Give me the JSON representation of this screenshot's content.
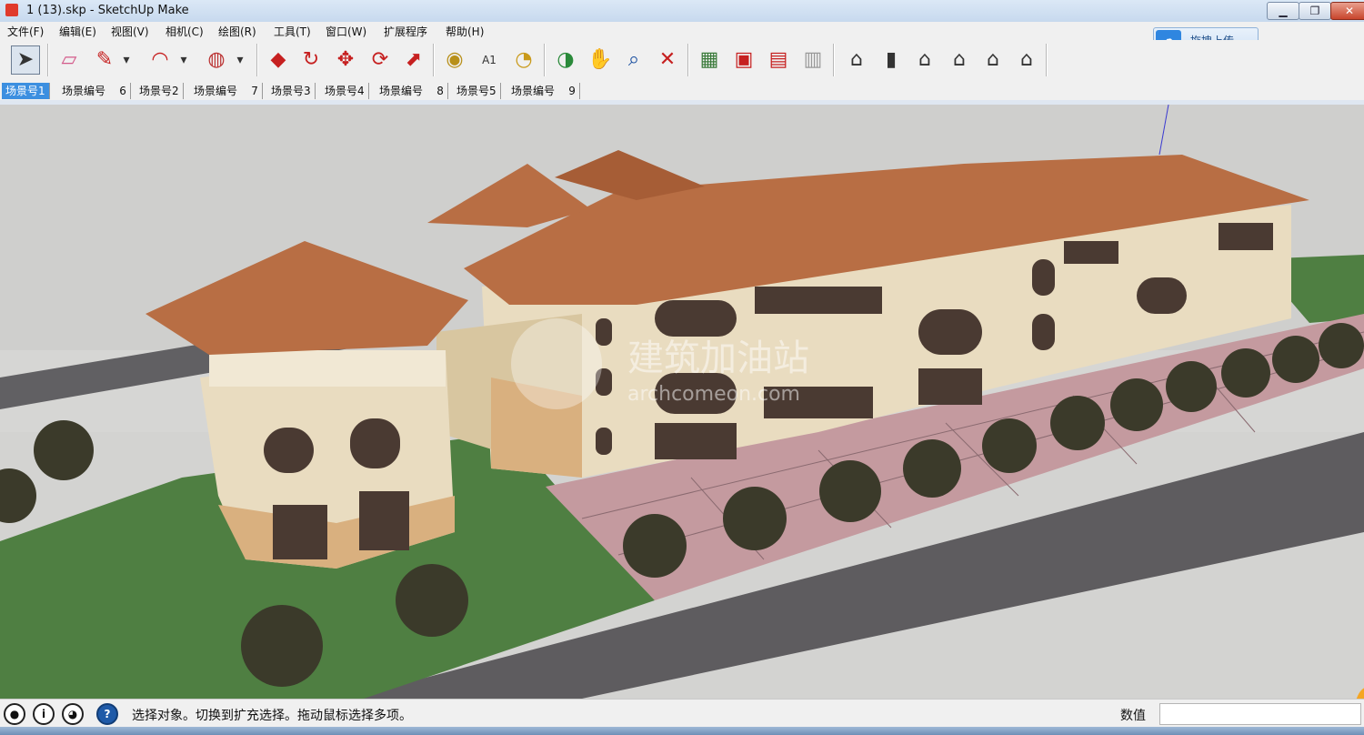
{
  "window": {
    "title": "1 (13).skp - SketchUp Make",
    "min_label": "▁",
    "max_label": "❐",
    "close_label": "✕"
  },
  "menu": [
    "文件(F)",
    "编辑(E)",
    "视图(V)",
    "相机(C)",
    "绘图(R)",
    "工具(T)",
    "窗口(W)",
    "扩展程序",
    "帮助(H)"
  ],
  "upload": {
    "label": "拖拽上传"
  },
  "toolbar": {
    "select_glyph": "➤",
    "glyphs": [
      "▱",
      "✎",
      "▾",
      "◠",
      "▾",
      "◍",
      "▾",
      "◆",
      "↻",
      "✥",
      "⟳",
      "⬈",
      "◉",
      "A1",
      "◔",
      "◑",
      "✋",
      "⌕",
      "✕",
      "▦",
      "▣",
      "▤",
      "▥",
      "⌂",
      "▮",
      "⌂",
      "⌂",
      "⌂",
      "⌂"
    ]
  },
  "scenes": [
    "场景号1",
    "场景编号    6",
    "场景号2",
    "场景编号    7",
    "场景号3",
    "场景号4",
    "场景编号    8",
    "场景号5",
    "场景编号    9"
  ],
  "watermark": {
    "line1": "建筑加油站",
    "line2": "archcomeon.com"
  },
  "status": {
    "icons": [
      "pin-icon",
      "info-icon",
      "user-icon",
      "help-icon"
    ],
    "icon_glyphs": [
      "●",
      "i",
      "◕",
      "?"
    ],
    "message": "选择对象。切换到扩充选择。拖动鼠标选择多项。",
    "measure_label": "数值",
    "measure_value": ""
  },
  "colors": {
    "roof": "#b86e44",
    "wall": "#e9dcc0",
    "plaza": "#c49a9f",
    "grass": "#4f7f42",
    "road": "#5e5c5f",
    "ground": "#d6d6d4"
  }
}
